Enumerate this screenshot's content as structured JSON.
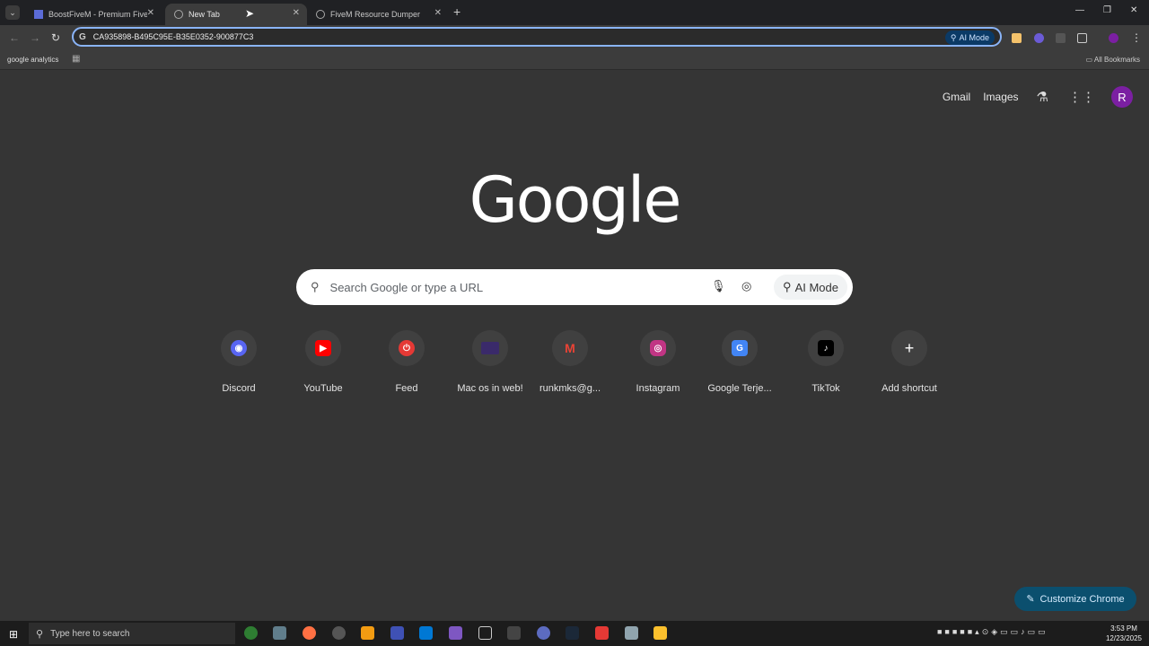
{
  "tabs": [
    {
      "title": "BoostFiveM - Premium FiveM U",
      "active": false
    },
    {
      "title": "New Tab",
      "active": true
    },
    {
      "title": "FiveM Resource Dumper",
      "active": false
    }
  ],
  "omnibox": {
    "value": "CA935898-B495C95E-B35E0352-900877C3",
    "ai_label": "AI Mode"
  },
  "bookmarks": {
    "google_analytics": "google analytics",
    "all_bookmarks": "All Bookmarks"
  },
  "ntp_header": {
    "gmail": "Gmail",
    "images": "Images",
    "avatar_initial": "R"
  },
  "logo": "Google",
  "search": {
    "placeholder": "Search Google or type a URL",
    "ai_mode": "AI Mode"
  },
  "shortcuts": [
    {
      "label": "Discord",
      "icon": "discord-icon",
      "color": "#5865F2"
    },
    {
      "label": "YouTube",
      "icon": "youtube-icon",
      "color": "#FF0000"
    },
    {
      "label": "Feed",
      "icon": "feed-icon",
      "color": "#E53935"
    },
    {
      "label": "Mac os in web!",
      "icon": "macos-icon",
      "color": "#3a2a6a"
    },
    {
      "label": "runkmks@g...",
      "icon": "gmail-icon",
      "color": "#EA4335"
    },
    {
      "label": "Instagram",
      "icon": "instagram-icon",
      "color": "#C13584"
    },
    {
      "label": "Google Terje...",
      "icon": "translate-icon",
      "color": "#4285F4"
    },
    {
      "label": "TikTok",
      "icon": "tiktok-icon",
      "color": "#000000"
    },
    {
      "label": "Add shortcut",
      "icon": "plus-icon",
      "color": "#404040"
    }
  ],
  "customize": "Customize Chrome",
  "taskbar": {
    "search_placeholder": "Type here to search",
    "time": "3:53 PM",
    "date": "12/23/2025"
  }
}
